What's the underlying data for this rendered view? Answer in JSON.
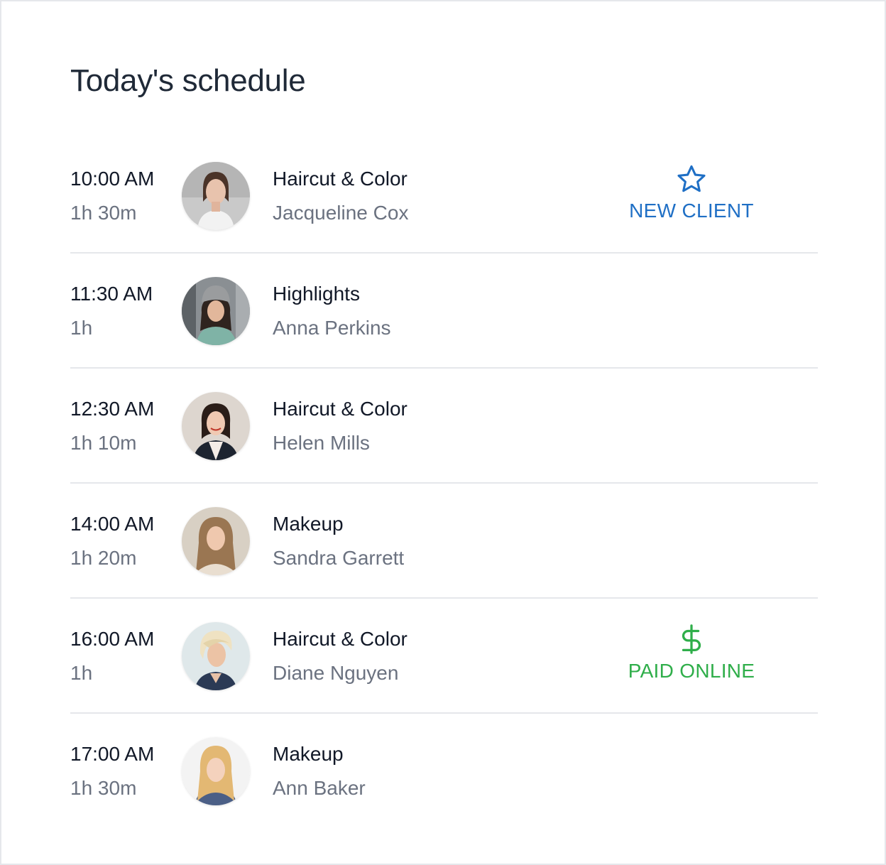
{
  "title": "Today's schedule",
  "colors": {
    "new_client": "#1f6fc5",
    "paid_online": "#2fae4a"
  },
  "appointments": [
    {
      "time": "10:00 AM",
      "duration": "1h 30m",
      "service": "Haircut & Color",
      "client": "Jacqueline Cox",
      "badge": {
        "icon": "star-icon",
        "label": "NEW CLIENT"
      }
    },
    {
      "time": "11:30 AM",
      "duration": "1h",
      "service": "Highlights",
      "client": "Anna Perkins"
    },
    {
      "time": "12:30 AM",
      "duration": "1h 10m",
      "service": "Haircut & Color",
      "client": "Helen Mills"
    },
    {
      "time": "14:00 AM",
      "duration": "1h 20m",
      "service": "Makeup",
      "client": "Sandra Garrett"
    },
    {
      "time": "16:00 AM",
      "duration": "1h",
      "service": "Haircut & Color",
      "client": "Diane Nguyen",
      "badge": {
        "icon": "dollar-icon",
        "label": "PAID ONLINE"
      }
    },
    {
      "time": "17:00 AM",
      "duration": "1h 30m",
      "service": "Makeup",
      "client": "Ann Baker"
    }
  ]
}
